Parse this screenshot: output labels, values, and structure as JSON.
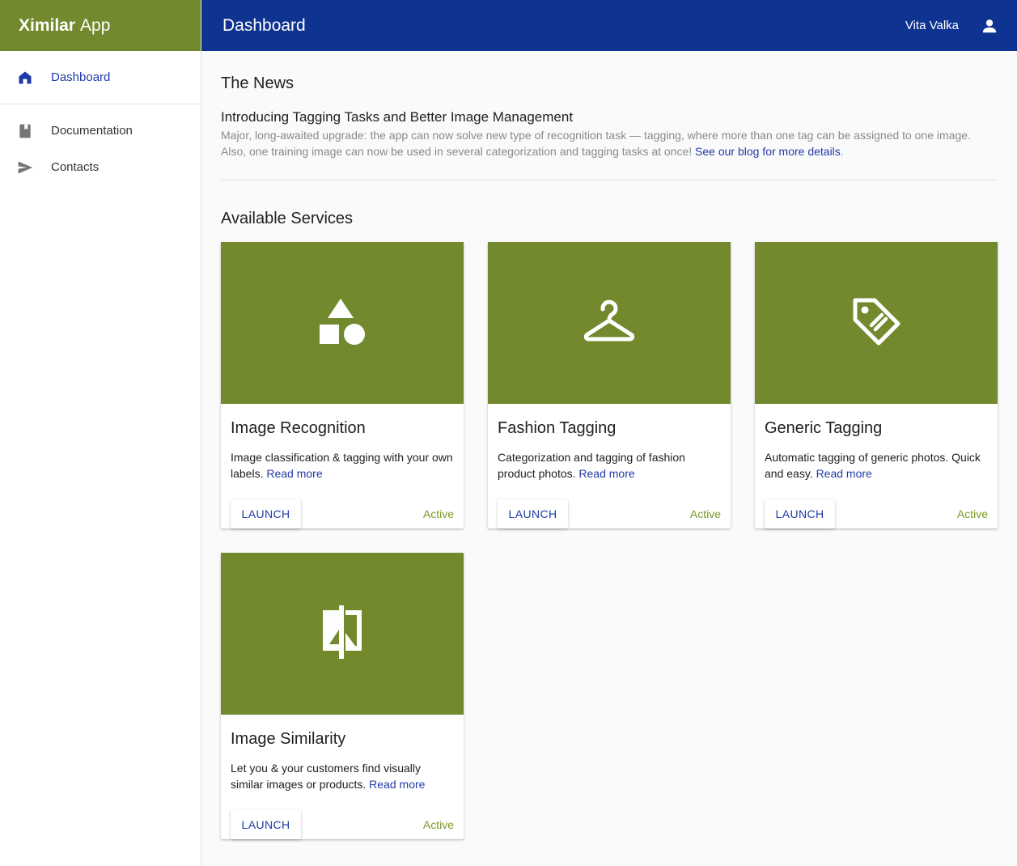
{
  "app": {
    "brand_bold": "Ximilar",
    "brand_rest": "App"
  },
  "sidebar": {
    "items": [
      {
        "label": "Dashboard",
        "icon": "home-icon",
        "active": true
      },
      {
        "label": "Documentation",
        "icon": "book-icon"
      },
      {
        "label": "Contacts",
        "icon": "send-icon"
      }
    ]
  },
  "header": {
    "title": "Dashboard",
    "user_name": "Vita Valka",
    "user_icon": "account-icon"
  },
  "news": {
    "heading": "The News",
    "title": "Introducing Tagging Tasks and Better Image Management",
    "body": "Major, long-awaited upgrade: the app can now solve new type of recognition task — tagging, where more than one tag can be assigned to one image. Also, one training image can now be used in several categorization and tagging tasks at once! ",
    "link": "See our blog for more details",
    "tail": "."
  },
  "services": {
    "heading": "Available Services",
    "launch_label": "LAUNCH",
    "read_more": "Read more",
    "cards": [
      {
        "title": "Image Recognition",
        "desc": "Image classification & tagging with your own labels. ",
        "status": "Active",
        "icon": "shapes-icon"
      },
      {
        "title": "Fashion Tagging",
        "desc": "Categorization and tagging of fashion product photos. ",
        "status": "Active",
        "icon": "hanger-icon"
      },
      {
        "title": "Generic Tagging",
        "desc": "Automatic tagging of generic photos. Quick and easy. ",
        "status": "Active",
        "icon": "tag-icon"
      },
      {
        "title": "Image Similarity",
        "desc": "Let you & your customers find visually similar images or products. ",
        "status": "Active",
        "icon": "compare-icon"
      }
    ]
  },
  "colors": {
    "brand_green": "#728a2d",
    "header_blue": "#0e3391",
    "link_blue": "#1f3aa8",
    "active_green": "#7a9a22"
  }
}
